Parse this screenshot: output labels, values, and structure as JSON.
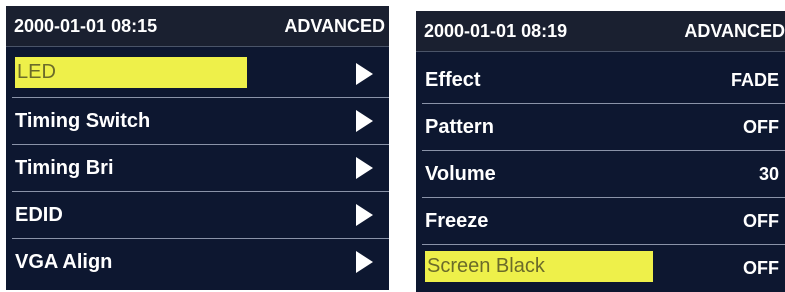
{
  "left_screen": {
    "header": {
      "datetime": "2000-01-01 08:15",
      "mode": "ADVANCED"
    },
    "items": [
      {
        "label": "LED",
        "selected": true
      },
      {
        "label": "Timing Switch"
      },
      {
        "label": "Timing Bri"
      },
      {
        "label": "EDID"
      },
      {
        "label": "VGA Align"
      }
    ],
    "highlight_color": "#eef04a",
    "background_color": "#0d1730"
  },
  "right_screen": {
    "header": {
      "datetime": "2000-01-01 08:19",
      "mode": "ADVANCED"
    },
    "items": [
      {
        "label": "Effect",
        "value": "FADE"
      },
      {
        "label": "Pattern",
        "value": "OFF"
      },
      {
        "label": "Volume",
        "value": "30"
      },
      {
        "label": "Freeze",
        "value": "OFF"
      },
      {
        "label": "Screen Black",
        "value": "OFF",
        "selected": true
      }
    ]
  }
}
